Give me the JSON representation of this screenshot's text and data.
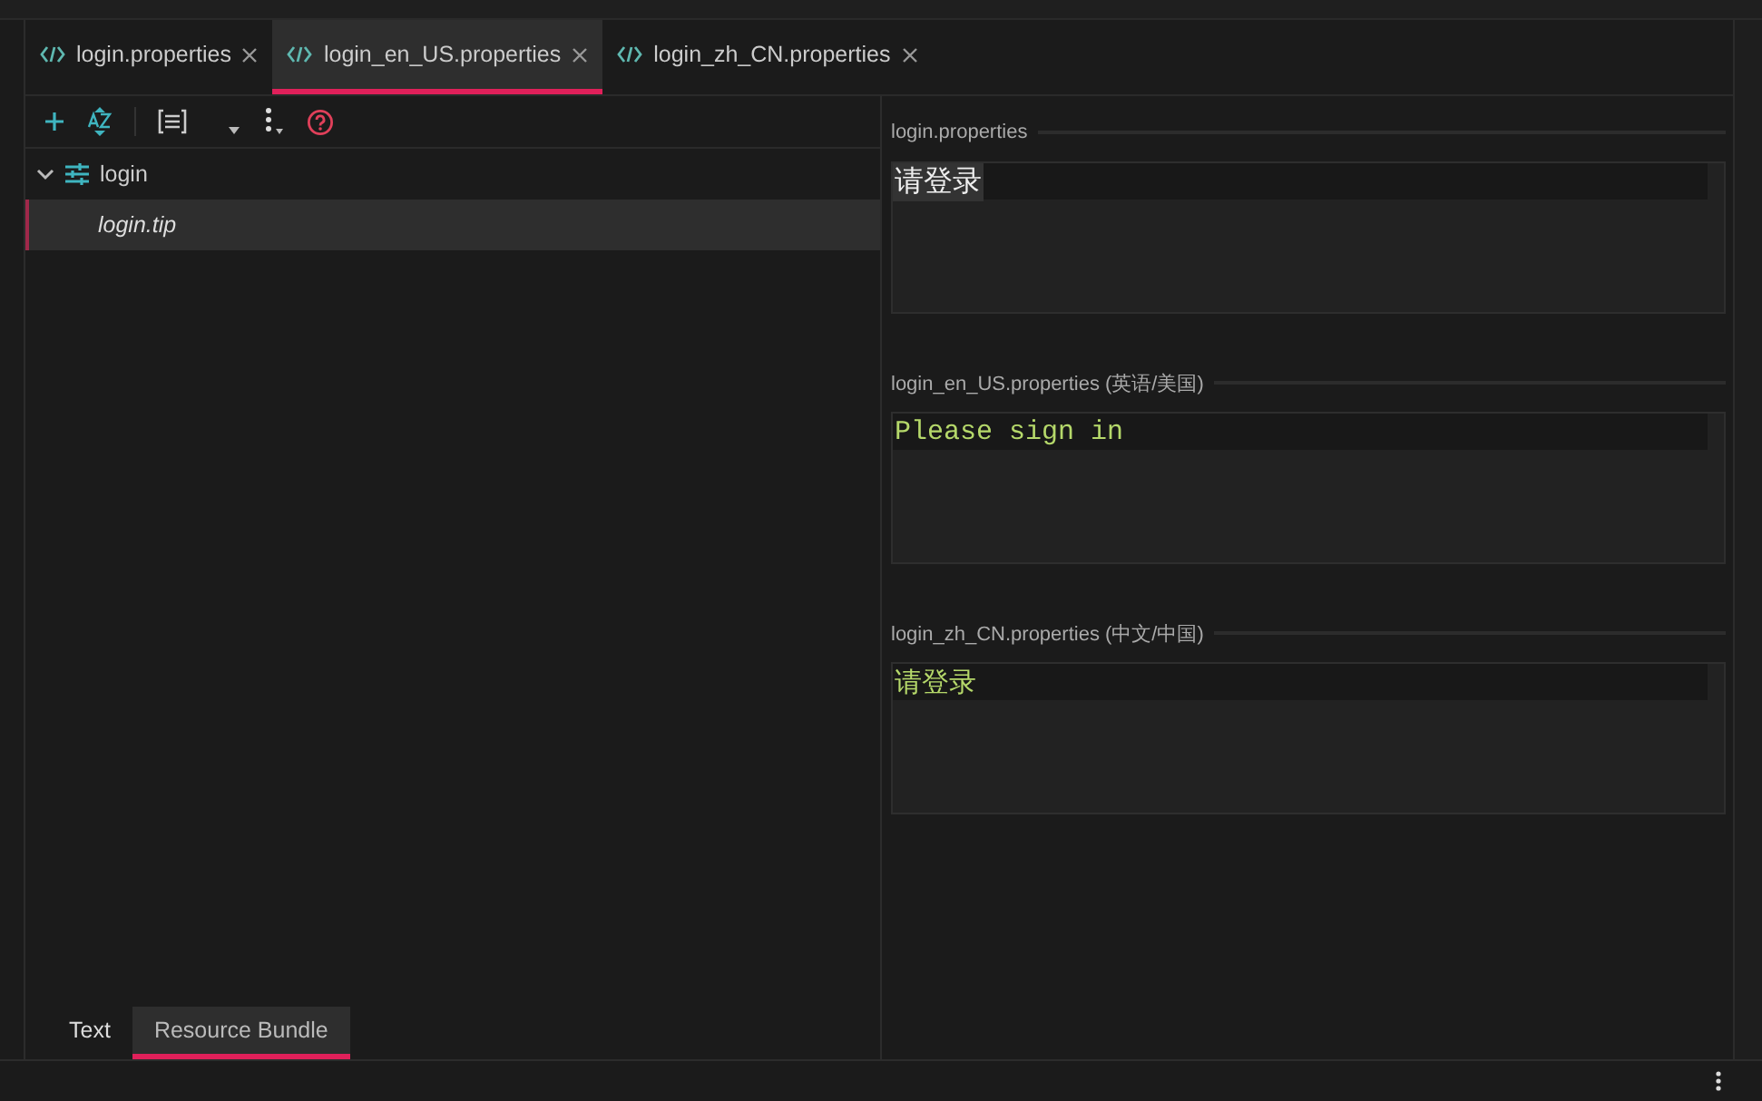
{
  "tabs": [
    {
      "label": "login.properties",
      "selected": false
    },
    {
      "label": "login_en_US.properties",
      "selected": true
    },
    {
      "label": "login_zh_CN.properties",
      "selected": false
    }
  ],
  "tree": [
    {
      "label": "login",
      "expanded": true,
      "children": [
        {
          "label": "login.tip",
          "selected": true
        }
      ]
    }
  ],
  "editors": [
    {
      "header": "login.properties",
      "value": "请登录",
      "kind": "base"
    },
    {
      "header": "login_en_US.properties (英语/美国)",
      "value": "Please sign in",
      "kind": "locale"
    },
    {
      "header": "login_zh_CN.properties (中文/中国)",
      "value": "请登录",
      "kind": "locale"
    }
  ],
  "bottom_tabs": [
    {
      "label": "Text",
      "selected": false
    },
    {
      "label": "Resource Bundle",
      "selected": true
    }
  ]
}
